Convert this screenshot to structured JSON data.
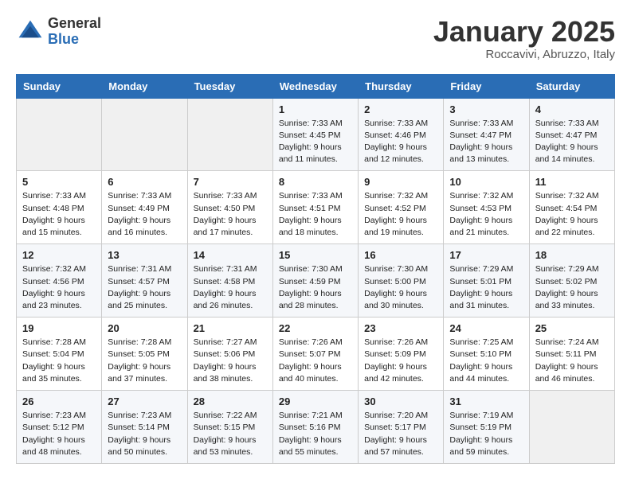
{
  "header": {
    "logo_general": "General",
    "logo_blue": "Blue",
    "month_title": "January 2025",
    "location": "Roccavivi, Abruzzo, Italy"
  },
  "days_of_week": [
    "Sunday",
    "Monday",
    "Tuesday",
    "Wednesday",
    "Thursday",
    "Friday",
    "Saturday"
  ],
  "weeks": [
    [
      {
        "day": "",
        "sunrise": "",
        "sunset": "",
        "daylight": ""
      },
      {
        "day": "",
        "sunrise": "",
        "sunset": "",
        "daylight": ""
      },
      {
        "day": "",
        "sunrise": "",
        "sunset": "",
        "daylight": ""
      },
      {
        "day": "1",
        "sunrise": "Sunrise: 7:33 AM",
        "sunset": "Sunset: 4:45 PM",
        "daylight": "Daylight: 9 hours and 11 minutes."
      },
      {
        "day": "2",
        "sunrise": "Sunrise: 7:33 AM",
        "sunset": "Sunset: 4:46 PM",
        "daylight": "Daylight: 9 hours and 12 minutes."
      },
      {
        "day": "3",
        "sunrise": "Sunrise: 7:33 AM",
        "sunset": "Sunset: 4:47 PM",
        "daylight": "Daylight: 9 hours and 13 minutes."
      },
      {
        "day": "4",
        "sunrise": "Sunrise: 7:33 AM",
        "sunset": "Sunset: 4:47 PM",
        "daylight": "Daylight: 9 hours and 14 minutes."
      }
    ],
    [
      {
        "day": "5",
        "sunrise": "Sunrise: 7:33 AM",
        "sunset": "Sunset: 4:48 PM",
        "daylight": "Daylight: 9 hours and 15 minutes."
      },
      {
        "day": "6",
        "sunrise": "Sunrise: 7:33 AM",
        "sunset": "Sunset: 4:49 PM",
        "daylight": "Daylight: 9 hours and 16 minutes."
      },
      {
        "day": "7",
        "sunrise": "Sunrise: 7:33 AM",
        "sunset": "Sunset: 4:50 PM",
        "daylight": "Daylight: 9 hours and 17 minutes."
      },
      {
        "day": "8",
        "sunrise": "Sunrise: 7:33 AM",
        "sunset": "Sunset: 4:51 PM",
        "daylight": "Daylight: 9 hours and 18 minutes."
      },
      {
        "day": "9",
        "sunrise": "Sunrise: 7:32 AM",
        "sunset": "Sunset: 4:52 PM",
        "daylight": "Daylight: 9 hours and 19 minutes."
      },
      {
        "day": "10",
        "sunrise": "Sunrise: 7:32 AM",
        "sunset": "Sunset: 4:53 PM",
        "daylight": "Daylight: 9 hours and 21 minutes."
      },
      {
        "day": "11",
        "sunrise": "Sunrise: 7:32 AM",
        "sunset": "Sunset: 4:54 PM",
        "daylight": "Daylight: 9 hours and 22 minutes."
      }
    ],
    [
      {
        "day": "12",
        "sunrise": "Sunrise: 7:32 AM",
        "sunset": "Sunset: 4:56 PM",
        "daylight": "Daylight: 9 hours and 23 minutes."
      },
      {
        "day": "13",
        "sunrise": "Sunrise: 7:31 AM",
        "sunset": "Sunset: 4:57 PM",
        "daylight": "Daylight: 9 hours and 25 minutes."
      },
      {
        "day": "14",
        "sunrise": "Sunrise: 7:31 AM",
        "sunset": "Sunset: 4:58 PM",
        "daylight": "Daylight: 9 hours and 26 minutes."
      },
      {
        "day": "15",
        "sunrise": "Sunrise: 7:30 AM",
        "sunset": "Sunset: 4:59 PM",
        "daylight": "Daylight: 9 hours and 28 minutes."
      },
      {
        "day": "16",
        "sunrise": "Sunrise: 7:30 AM",
        "sunset": "Sunset: 5:00 PM",
        "daylight": "Daylight: 9 hours and 30 minutes."
      },
      {
        "day": "17",
        "sunrise": "Sunrise: 7:29 AM",
        "sunset": "Sunset: 5:01 PM",
        "daylight": "Daylight: 9 hours and 31 minutes."
      },
      {
        "day": "18",
        "sunrise": "Sunrise: 7:29 AM",
        "sunset": "Sunset: 5:02 PM",
        "daylight": "Daylight: 9 hours and 33 minutes."
      }
    ],
    [
      {
        "day": "19",
        "sunrise": "Sunrise: 7:28 AM",
        "sunset": "Sunset: 5:04 PM",
        "daylight": "Daylight: 9 hours and 35 minutes."
      },
      {
        "day": "20",
        "sunrise": "Sunrise: 7:28 AM",
        "sunset": "Sunset: 5:05 PM",
        "daylight": "Daylight: 9 hours and 37 minutes."
      },
      {
        "day": "21",
        "sunrise": "Sunrise: 7:27 AM",
        "sunset": "Sunset: 5:06 PM",
        "daylight": "Daylight: 9 hours and 38 minutes."
      },
      {
        "day": "22",
        "sunrise": "Sunrise: 7:26 AM",
        "sunset": "Sunset: 5:07 PM",
        "daylight": "Daylight: 9 hours and 40 minutes."
      },
      {
        "day": "23",
        "sunrise": "Sunrise: 7:26 AM",
        "sunset": "Sunset: 5:09 PM",
        "daylight": "Daylight: 9 hours and 42 minutes."
      },
      {
        "day": "24",
        "sunrise": "Sunrise: 7:25 AM",
        "sunset": "Sunset: 5:10 PM",
        "daylight": "Daylight: 9 hours and 44 minutes."
      },
      {
        "day": "25",
        "sunrise": "Sunrise: 7:24 AM",
        "sunset": "Sunset: 5:11 PM",
        "daylight": "Daylight: 9 hours and 46 minutes."
      }
    ],
    [
      {
        "day": "26",
        "sunrise": "Sunrise: 7:23 AM",
        "sunset": "Sunset: 5:12 PM",
        "daylight": "Daylight: 9 hours and 48 minutes."
      },
      {
        "day": "27",
        "sunrise": "Sunrise: 7:23 AM",
        "sunset": "Sunset: 5:14 PM",
        "daylight": "Daylight: 9 hours and 50 minutes."
      },
      {
        "day": "28",
        "sunrise": "Sunrise: 7:22 AM",
        "sunset": "Sunset: 5:15 PM",
        "daylight": "Daylight: 9 hours and 53 minutes."
      },
      {
        "day": "29",
        "sunrise": "Sunrise: 7:21 AM",
        "sunset": "Sunset: 5:16 PM",
        "daylight": "Daylight: 9 hours and 55 minutes."
      },
      {
        "day": "30",
        "sunrise": "Sunrise: 7:20 AM",
        "sunset": "Sunset: 5:17 PM",
        "daylight": "Daylight: 9 hours and 57 minutes."
      },
      {
        "day": "31",
        "sunrise": "Sunrise: 7:19 AM",
        "sunset": "Sunset: 5:19 PM",
        "daylight": "Daylight: 9 hours and 59 minutes."
      },
      {
        "day": "",
        "sunrise": "",
        "sunset": "",
        "daylight": ""
      }
    ]
  ]
}
